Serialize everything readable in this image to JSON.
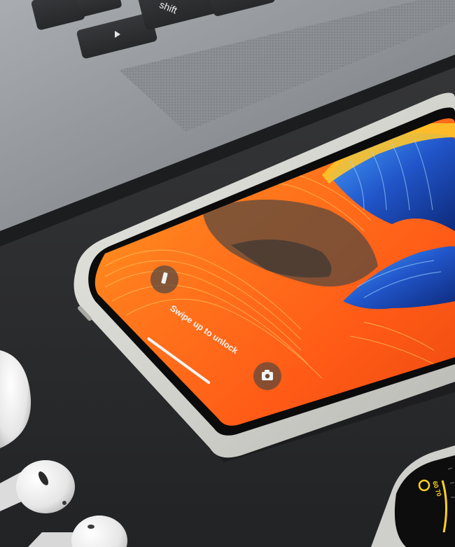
{
  "laptop": {
    "keys": [
      {
        "label": ""
      },
      {
        "label": ""
      },
      {
        "label": "shift"
      },
      {
        "label": ""
      },
      {
        "label": ""
      }
    ]
  },
  "phone": {
    "lock_screen": {
      "unlock_hint": "Swipe up to unlock",
      "left_button_icon": "flashlight-icon",
      "right_button_icon": "camera-icon"
    }
  },
  "watch": {
    "complication_text": "60 70"
  },
  "colors": {
    "desk": "#2b2c2e",
    "laptop_body": "#9ea2a6",
    "phone_case": "#d9d9d4",
    "wallpaper_orange": "#ff6a1a",
    "wallpaper_blue": "#2155c9",
    "wallpaper_yellow": "#ffb21f",
    "airpods": "#f3f3f3"
  }
}
